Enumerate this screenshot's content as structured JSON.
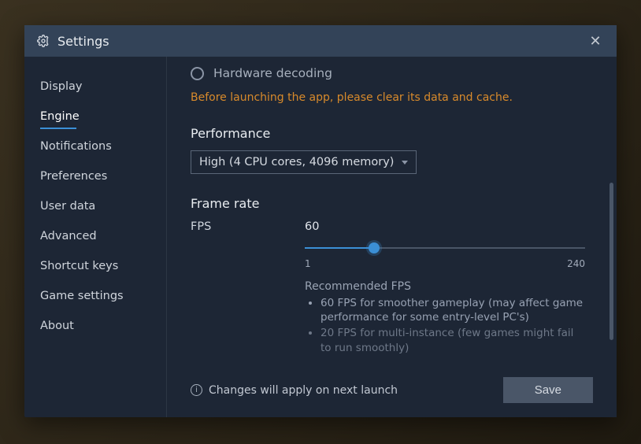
{
  "title": "Settings",
  "sidebar": {
    "items": [
      {
        "label": "Display"
      },
      {
        "label": "Engine"
      },
      {
        "label": "Notifications"
      },
      {
        "label": "Preferences"
      },
      {
        "label": "User data"
      },
      {
        "label": "Advanced"
      },
      {
        "label": "Shortcut keys"
      },
      {
        "label": "Game settings"
      },
      {
        "label": "About"
      }
    ],
    "activeIndex": 1
  },
  "engine": {
    "hardware_decoding_label": "Hardware decoding",
    "warning": "Before launching the app, please clear its data and cache.",
    "performance_title": "Performance",
    "performance_value": "High (4 CPU cores, 4096 memory)",
    "frame_rate_title": "Frame rate",
    "fps_label": "FPS",
    "fps_value": "60",
    "fps_min": "1",
    "fps_max": "240",
    "rec_title": "Recommended FPS",
    "rec1": "60 FPS for smoother gameplay (may affect game performance for some entry-level PC's)",
    "rec2": "20 FPS for multi-instance (few games might fail to run smoothly)"
  },
  "footer": {
    "note": "Changes will apply on next launch",
    "save": "Save"
  }
}
